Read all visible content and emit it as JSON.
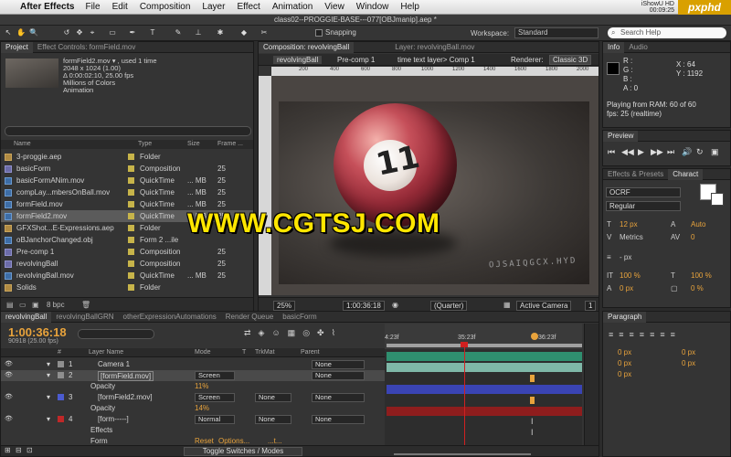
{
  "menubar": {
    "apple": "",
    "app": "After Effects",
    "items": [
      "File",
      "Edit",
      "Composition",
      "Layer",
      "Effect",
      "Animation",
      "View",
      "Window",
      "Help"
    ],
    "clock_top": "iShowU HD",
    "clock_bottom": "00:09:25",
    "logo": "pxphd"
  },
  "toolbar": {
    "doc_title": "class02--PROGGIE-BASE---077[OBJmanip].aep *",
    "tools": [
      "↖",
      "✋",
      "🔍",
      "↺",
      "✥",
      "⌖",
      "▭",
      "✒",
      "T",
      "✎",
      "⊥",
      "✱",
      "◆",
      "✂"
    ],
    "snapping": "Snapping",
    "workspace_label": "Workspace:",
    "workspace_value": "Standard",
    "search_help": "Search Help"
  },
  "project": {
    "tabs": [
      "Project",
      "Effect Controls: formField.mov"
    ],
    "info_name": "formField2.mov ▾ , used 1 time",
    "info_lines": [
      "2048 x 1024 (1.00)",
      "Δ 0:00:02:10, 25.00 fps",
      "Millions of Colors",
      "Animation"
    ],
    "columns": [
      "Name",
      "Type",
      "Size",
      "Frame ..."
    ],
    "rows": [
      {
        "name": "3-proggie.aep",
        "type": "Folder",
        "size": "",
        "fr": "",
        "icon": "folder",
        "swatch": "#c7b44a"
      },
      {
        "name": "basicForm",
        "type": "Composition",
        "size": "",
        "fr": "25",
        "icon": "comp",
        "swatch": "#c7b44a"
      },
      {
        "name": "basicFormANim.mov",
        "type": "QuickTime",
        "size": "... MB",
        "fr": "25",
        "icon": "mov",
        "swatch": "#c7b44a"
      },
      {
        "name": "compLay...mbersOnBall.mov",
        "type": "QuickTime",
        "size": "... MB",
        "fr": "25",
        "icon": "mov",
        "swatch": "#c7b44a"
      },
      {
        "name": "formField.mov",
        "type": "QuickTime",
        "size": "... MB",
        "fr": "25",
        "icon": "mov",
        "swatch": "#c7b44a"
      },
      {
        "name": "formField2.mov",
        "type": "QuickTime",
        "size": "... MB",
        "fr": "25",
        "icon": "mov",
        "swatch": "#c7b44a",
        "selected": true
      },
      {
        "name": "GFXShot...E-Expressions.aep",
        "type": "Folder",
        "size": "",
        "fr": "",
        "icon": "folder",
        "swatch": "#c7b44a"
      },
      {
        "name": "oBJanchorChanged.obj",
        "type": "Form 2 ...ile",
        "size": "",
        "fr": "",
        "icon": "mov",
        "swatch": "#c7b44a"
      },
      {
        "name": "Pre-comp 1",
        "type": "Composition",
        "size": "",
        "fr": "25",
        "icon": "comp",
        "swatch": "#c7b44a"
      },
      {
        "name": "revolvingBall",
        "type": "Composition",
        "size": "",
        "fr": "25",
        "icon": "comp",
        "swatch": "#c7b44a"
      },
      {
        "name": "revolvingBall.mov",
        "type": "QuickTime",
        "size": "... MB",
        "fr": "25",
        "icon": "mov",
        "swatch": "#c7b44a"
      },
      {
        "name": "Solids",
        "type": "Folder",
        "size": "",
        "fr": "",
        "icon": "folder",
        "swatch": "#c7b44a"
      }
    ],
    "footer_bpc": "8 bpc"
  },
  "comp": {
    "tabs": [
      "Composition: revolvingBall",
      "Layer: revolvingBall.mov"
    ],
    "nav": [
      "revolvingBall",
      "Pre-comp 1",
      "time text layer> Comp 1"
    ],
    "renderer_label": "Renderer:",
    "renderer_value": "Classic 3D",
    "ruler": [
      "200",
      "400",
      "600",
      "800",
      "1000",
      "1200",
      "1400",
      "1600",
      "1800",
      "2000"
    ],
    "ball_number": "11",
    "floor_text": "OJSAIQGCX.HYD",
    "footer": {
      "zoom": "25%",
      "time": "1:00:36:18",
      "quality": "(Quarter)",
      "camera": "Active Camera",
      "view": "1"
    }
  },
  "watermark": "WWW.CGTSJ.COM",
  "info": {
    "tabs": [
      "Info",
      "Audio"
    ],
    "r": "R :",
    "g": "G :",
    "b": "B :",
    "a": "A : 0",
    "x": "X : 64",
    "y": "Y : 1192",
    "playing": "Playing from RAM: 60 of 60",
    "fps": "fps: 25 (realtime)"
  },
  "preview": {
    "tab": "Preview",
    "buttons": [
      "⏮",
      "◀◀",
      "▶",
      "▶▶",
      "⏭",
      "🔊",
      "↻",
      "▣"
    ]
  },
  "character": {
    "tabs": [
      "Effects & Presets",
      "Charact"
    ],
    "font": "OCRF",
    "style": "Regular",
    "size": "12 px",
    "leading": "Auto",
    "kerning_label": "Metrics",
    "tracking": "0",
    "stroke": "- px",
    "vscale": "100 %",
    "hscale": "100 %",
    "baseline": "0 px",
    "tsume": "0 %"
  },
  "paragraph": {
    "tab": "Paragraph",
    "indent_left": "0 px",
    "indent_right": "0 px",
    "space_before": "0 px",
    "space_after": "0 px",
    "first_indent": "0 px"
  },
  "timeline": {
    "tabs": [
      "revolvingBall",
      "revolvingBallGRN",
      "otherExpressionAutomations",
      "Render Queue",
      "basicForm"
    ],
    "current_time": "1:00:36:18",
    "frames": "90918 (25.00 fps)",
    "columns": [
      "#",
      "Layer Name",
      "Mode",
      "T",
      "TrkMat",
      "Parent"
    ],
    "ruler_labels": [
      "4:23f",
      "35:23f",
      "36:23f"
    ],
    "layers": [
      {
        "num": "1",
        "name": "Camera 1",
        "mode": "",
        "trk": "",
        "parent": "None",
        "color": "#8f8f8f",
        "bar": "#2f8f6f"
      },
      {
        "num": "2",
        "name": "[formField.mov]",
        "mode": "Screen",
        "trk": "",
        "parent": "None",
        "color": "#8f8f8f",
        "bar": "#7fb8a8",
        "selected": true
      },
      {
        "num": "",
        "name": "Opacity",
        "mode": "11%",
        "trk": "",
        "parent": "",
        "color": "",
        "bar": "",
        "prop": true
      },
      {
        "num": "3",
        "name": "[formField2.mov]",
        "mode": "Screen",
        "trk": "None",
        "parent": "None",
        "color": "#4b5bd0",
        "bar": "#3a44b4"
      },
      {
        "num": "",
        "name": "Opacity",
        "mode": "14%",
        "trk": "",
        "parent": "",
        "color": "",
        "bar": "",
        "prop": true
      },
      {
        "num": "4",
        "name": "[form-----]",
        "mode": "Normal",
        "trk": "None",
        "parent": "None",
        "color": "#c02828",
        "bar": "#8e1d1d"
      },
      {
        "num": "",
        "name": "Effects",
        "mode": "",
        "trk": "",
        "parent": "",
        "color": "",
        "bar": "",
        "prop": true
      },
      {
        "num": "",
        "name": "Form",
        "mode": "Reset",
        "trk": "Options...",
        "parent": "...t...",
        "color": "",
        "bar": "",
        "prop": true
      }
    ],
    "toggle_switches": "Toggle Switches / Modes"
  }
}
